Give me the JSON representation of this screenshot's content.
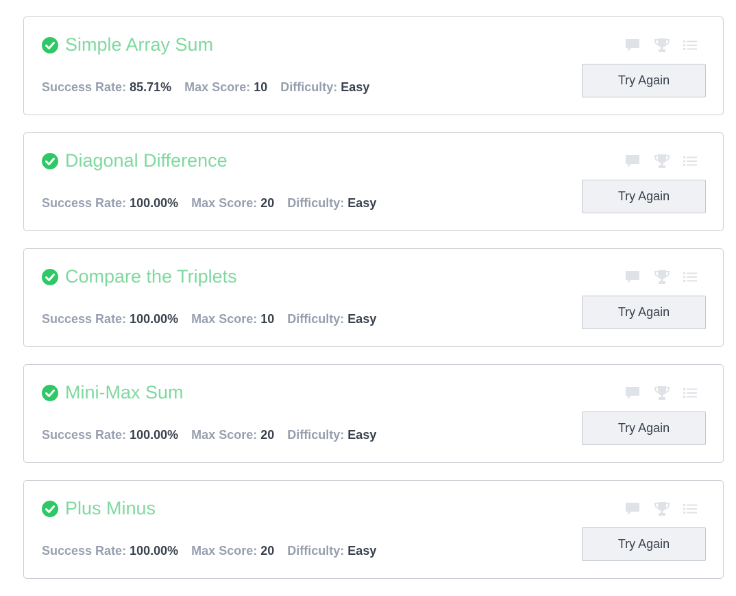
{
  "colors": {
    "solved_check": "#2ec866",
    "title": "#7fd99f",
    "stat_label": "#979faf",
    "stat_value": "#39424e",
    "muted_icon": "#dfe2e7",
    "button_bg": "#f0f1f4",
    "card_border": "#c9cdd3"
  },
  "labels": {
    "success_rate": "Success Rate:",
    "max_score": "Max Score:",
    "difficulty": "Difficulty:",
    "button": "Try Again"
  },
  "icons": [
    "discussion-icon",
    "leaderboard-trophy-icon",
    "editorial-list-icon"
  ],
  "challenges": [
    {
      "title": "Simple Array Sum",
      "solved": true,
      "success_rate": "85.71%",
      "max_score": "10",
      "difficulty": "Easy"
    },
    {
      "title": "Diagonal Difference",
      "solved": true,
      "success_rate": "100.00%",
      "max_score": "20",
      "difficulty": "Easy"
    },
    {
      "title": "Compare the Triplets",
      "solved": true,
      "success_rate": "100.00%",
      "max_score": "10",
      "difficulty": "Easy"
    },
    {
      "title": "Mini-Max Sum",
      "solved": true,
      "success_rate": "100.00%",
      "max_score": "20",
      "difficulty": "Easy"
    },
    {
      "title": "Plus Minus",
      "solved": true,
      "success_rate": "100.00%",
      "max_score": "20",
      "difficulty": "Easy"
    }
  ]
}
